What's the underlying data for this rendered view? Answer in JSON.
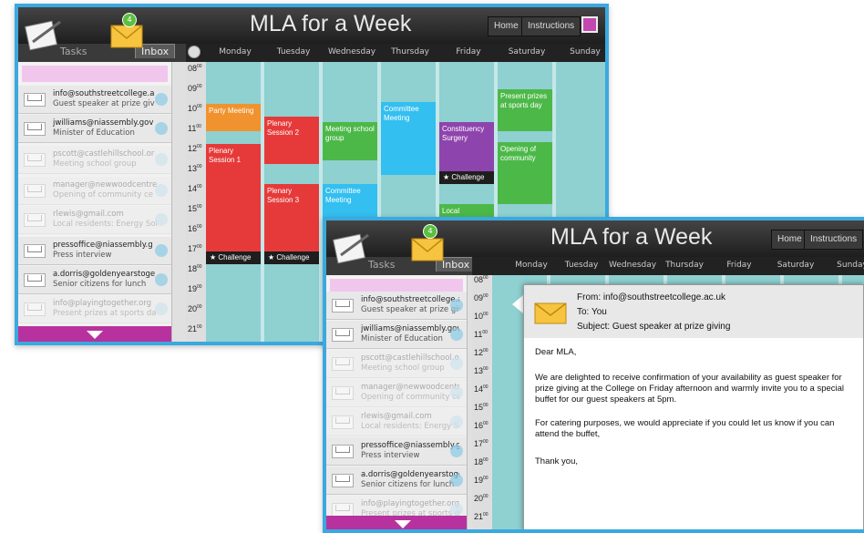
{
  "app": {
    "title": "MLA for a Week",
    "home_label": "Home",
    "instructions_label": "Instructions",
    "tasks_tab": "Tasks",
    "inbox_tab": "Inbox",
    "inbox_badge": "4"
  },
  "days": [
    "Monday",
    "Tuesday",
    "Wednesday",
    "Thursday",
    "Friday",
    "Saturday",
    "Sunday"
  ],
  "hours": [
    "08",
    "09",
    "10",
    "11",
    "12",
    "13",
    "14",
    "15",
    "16",
    "17",
    "18",
    "19",
    "20",
    "21"
  ],
  "hours_suffix": "00",
  "emails": [
    {
      "from": "info@southstreetcollege.a",
      "subject": "Guest speaker at prize giv",
      "faded": false
    },
    {
      "from": "jwilliams@niassembly.gov",
      "subject": "Minister of Education",
      "faded": false
    },
    {
      "from": "pscott@castlehillschool.or",
      "subject": "Meeting school group",
      "faded": true
    },
    {
      "from": "manager@newwoodcentre",
      "subject": "Opening of community ce",
      "faded": true
    },
    {
      "from": "rlewis@gmail.com",
      "subject": "Local residents: Energy Sol",
      "faded": true
    },
    {
      "from": "pressoffice@niassembly.g",
      "subject": "Press interview",
      "faded": false
    },
    {
      "from": "a.dorris@goldenyearstoge",
      "subject": "Senior citizens for lunch",
      "faded": false
    },
    {
      "from": "info@playingtogether.org",
      "subject": "Present prizes at sports da",
      "faded": true
    }
  ],
  "events": [
    {
      "label": "Party Meeting",
      "color": "#f0932f",
      "challenge": false
    },
    {
      "label": "Plenary Session 1",
      "color": "#e63a3a",
      "challenge": true
    },
    {
      "label": "Plenary Session 2",
      "color": "#e63a3a",
      "challenge": false
    },
    {
      "label": "Plenary Session 3",
      "color": "#e63a3a",
      "challenge": true
    },
    {
      "label": "Meeting school group",
      "color": "#4cb848",
      "challenge": false
    },
    {
      "label": "Committee Meeting",
      "color": "#33bff0",
      "challenge": false
    },
    {
      "label": "Committee Meeting",
      "color": "#33bff0",
      "challenge": false
    },
    {
      "label": "Constituency Surgery",
      "color": "#8e44ad",
      "challenge": true
    },
    {
      "label": "Local",
      "color": "#4cb848",
      "challenge": false
    },
    {
      "label": "Present prizes at sports day",
      "color": "#4cb848",
      "challenge": false
    },
    {
      "label": "Opening of community",
      "color": "#4cb848",
      "challenge": false
    }
  ],
  "challenge_label": "★ Challenge",
  "popup": {
    "from": "From: info@southstreetcollege.ac.uk",
    "to": "To: You",
    "subject": "Subject: Guest speaker at prize giving",
    "greeting": "Dear MLA,",
    "para1": "We are delighted to receive confirmation of your availability as guest speaker for prize giving at the College on Friday afternoon and warmly invite you to a special buffet for our guest speakers at 5pm.",
    "para2": "For catering purposes, we would appreciate if you could let us know if you can attend the buffet,",
    "closing": "Thank you,"
  }
}
